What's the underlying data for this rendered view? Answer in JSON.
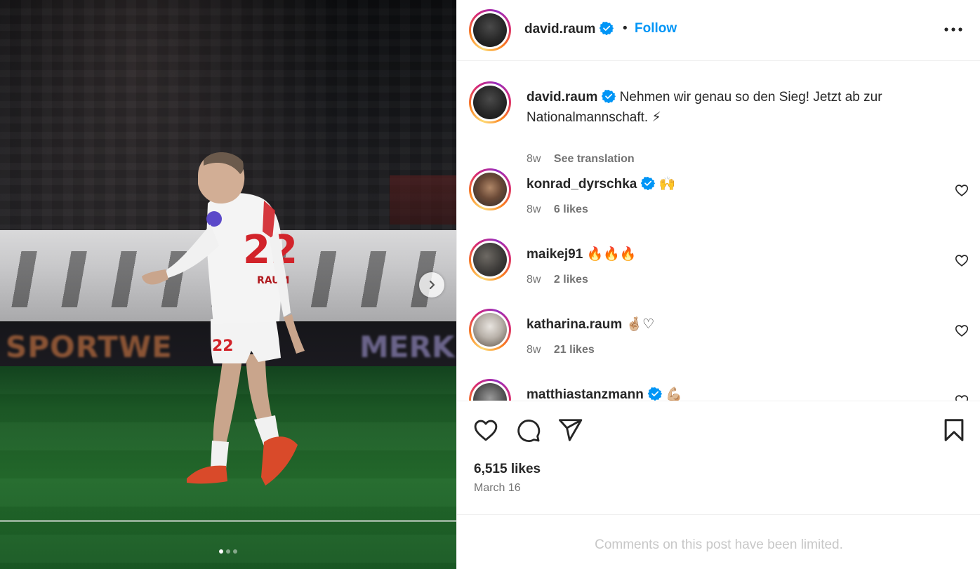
{
  "post": {
    "author": "david.raum",
    "follow_label": "Follow",
    "separator": "•",
    "caption": "Nehmen wir genau so den Sieg! Jetzt ab zur Nationalmannschaft.",
    "caption_emoji": "⚡",
    "caption_time": "8w",
    "see_translation": "See translation",
    "likes": "6,515 likes",
    "date": "March 16",
    "comments_limited": "Comments on this post have been limited."
  },
  "media": {
    "ad_left": "SPORTWE",
    "ad_right": "MERK",
    "slides_total": 3,
    "slide_active": 1
  },
  "comments": [
    {
      "username": "konrad_dyrschka",
      "verified": true,
      "text": "🙌",
      "time": "8w",
      "likes": "6 likes"
    },
    {
      "username": "maikej91",
      "verified": false,
      "text": "🔥🔥🔥",
      "time": "8w",
      "likes": "2 likes"
    },
    {
      "username": "katharina.raum",
      "verified": false,
      "text": "🤞🏼♡",
      "time": "8w",
      "likes": "21 likes"
    },
    {
      "username": "matthiastanzmann",
      "verified": true,
      "text": "💪🏼",
      "time": "",
      "likes": ""
    }
  ],
  "colors": {
    "accent": "#0095f6",
    "verified": "#0095f6",
    "text": "#262626",
    "secondary": "#737373",
    "limited": "#c7c7c7"
  },
  "icons": {
    "verified": "verified-badge-icon",
    "more": "more-options-icon",
    "heart": "heart-icon",
    "comment": "comment-icon",
    "share": "share-icon",
    "save": "bookmark-icon",
    "next": "chevron-right-icon"
  }
}
